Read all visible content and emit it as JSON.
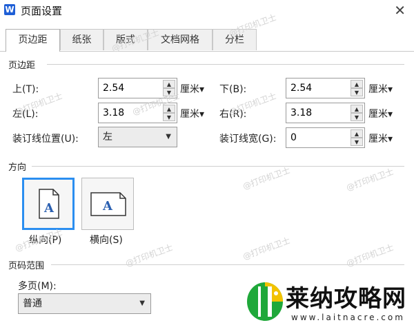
{
  "window": {
    "title": "页面设置",
    "app_icon_letter": "W",
    "close_glyph": "✕"
  },
  "tabs": [
    {
      "label": "页边距",
      "active": true
    },
    {
      "label": "纸张"
    },
    {
      "label": "版式"
    },
    {
      "label": "文档网格"
    },
    {
      "label": "分栏"
    }
  ],
  "margins": {
    "section_title": "页边距",
    "top": {
      "label": "上(T):",
      "value": "2.54",
      "unit": "厘米▾"
    },
    "bottom": {
      "label": "下(B):",
      "value": "2.54",
      "unit": "厘米▾"
    },
    "left": {
      "label": "左(L):",
      "value": "3.18",
      "unit": "厘米▾"
    },
    "right": {
      "label": "右(R):",
      "value": "3.18",
      "unit": "厘米▾"
    },
    "gutter_position": {
      "label": "装订线位置(U):",
      "value": "左"
    },
    "gutter_width": {
      "label": "装订线宽(G):",
      "value": "0",
      "unit": "厘米▾"
    }
  },
  "orientation": {
    "section_title": "方向",
    "portrait": {
      "label": "纵向(P)",
      "glyph": "A",
      "selected": true
    },
    "landscape": {
      "label": "横向(S)",
      "glyph": "A",
      "selected": false
    }
  },
  "pages": {
    "section_title": "页码范围",
    "multiple_label": "多页(M):",
    "multiple_value": "普通"
  },
  "watermark_text": "@打印机卫士",
  "brand": {
    "name": "莱纳攻略网",
    "url": "www.laitnacre.com"
  },
  "colors": {
    "selected_border": "#2b8ef0",
    "app_icon": "#1f5fd6",
    "brand_green": "#1fa83a"
  }
}
